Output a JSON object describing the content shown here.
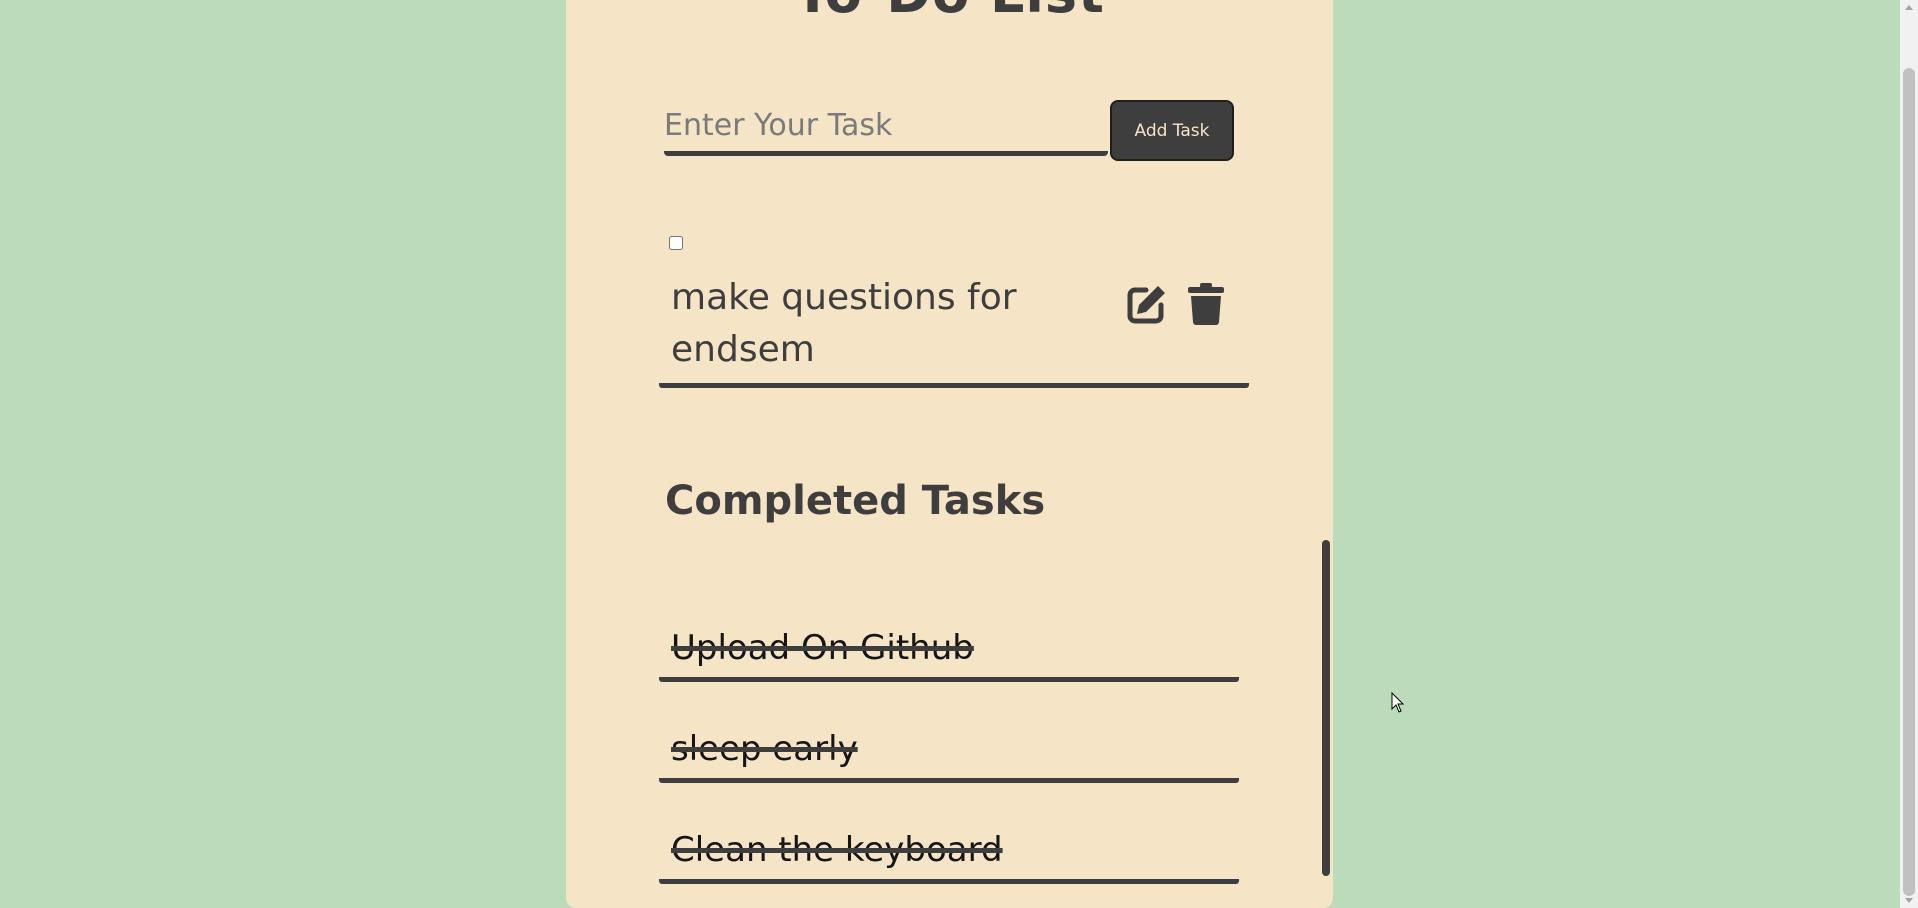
{
  "app": {
    "title": "To-Do List"
  },
  "input": {
    "placeholder": "Enter Your Task",
    "value": ""
  },
  "add_button": {
    "label": "Add Task"
  },
  "pending_tasks": [
    {
      "text": "make questions for endsem",
      "checked": false,
      "edit_icon": "edit-icon",
      "delete_icon": "trash-icon"
    }
  ],
  "completed": {
    "title": "Completed Tasks",
    "tasks": [
      {
        "text": "Upload On Github"
      },
      {
        "text": "sleep early"
      },
      {
        "text": "Clean the keyboard"
      }
    ]
  },
  "colors": {
    "page_background": "#bcdbbb",
    "card_background": "#f6e4c6",
    "accent_dark": "#3e3e3e",
    "button_text": "#f6e4c6"
  }
}
